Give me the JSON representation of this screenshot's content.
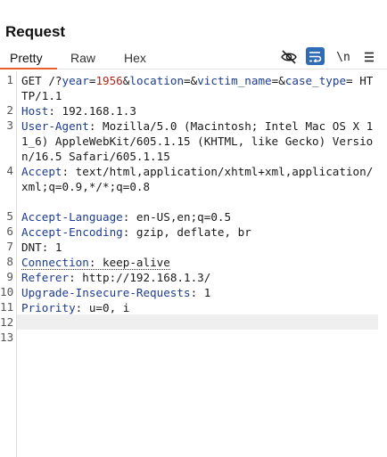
{
  "panel": {
    "title": "Request"
  },
  "tabs": [
    {
      "label": "Pretty",
      "active": true
    },
    {
      "label": "Raw",
      "active": false
    },
    {
      "label": "Hex",
      "active": false
    }
  ],
  "toolbar": {
    "eye_icon": "eye-slash-icon",
    "wrap_icon": "wrap-lines-icon",
    "newline_label": "\\n",
    "menu_icon": "hamburger-menu-icon",
    "accent_color": "#e8612c",
    "wrap_active_color": "#2f6cb3"
  },
  "request": {
    "line1": {
      "num": "1",
      "method": "GET /?",
      "p1": "year",
      "eq1": "=",
      "v1": "1956",
      "amp1": "&",
      "p2": "location",
      "eq2": "=&",
      "p3": "victim_name",
      "eq3": "=&",
      "p4": "case_type",
      "eq4": "=",
      "proto": " HTTP/1.1"
    },
    "headers": [
      {
        "num": "2",
        "name": "Host",
        "value": " 192.168.1.3"
      },
      {
        "num": "3",
        "name": "User-Agent",
        "value": " Mozilla/5.0 (Macintosh; Intel Mac OS X 11_6) AppleWebKit/605.1.15 (KHTML, like Gecko) Version/16.5 Safari/605.1.15"
      },
      {
        "num": "4",
        "name": "Accept",
        "value": " text/html,application/xhtml+xml,application/xml;q=0.9,*/*;q=0.8"
      },
      {
        "num": "5",
        "name": "Accept-Language",
        "value": " en-US,en;q=0.5"
      },
      {
        "num": "6",
        "name": "Accept-Encoding",
        "value": " gzip, deflate, br"
      },
      {
        "num": "7",
        "name": "DNT",
        "value": " 1"
      },
      {
        "num": "8",
        "name": "Connection",
        "value": " keep-alive"
      },
      {
        "num": "9",
        "name": "Referer",
        "value": " http://192.168.1.3/"
      },
      {
        "num": "10",
        "name": "Upgrade-Insecure-Requests",
        "value": " 1"
      },
      {
        "num": "11",
        "name": "Priority",
        "value": " u=0, i"
      }
    ],
    "empty_lines": [
      "12",
      "13"
    ]
  }
}
